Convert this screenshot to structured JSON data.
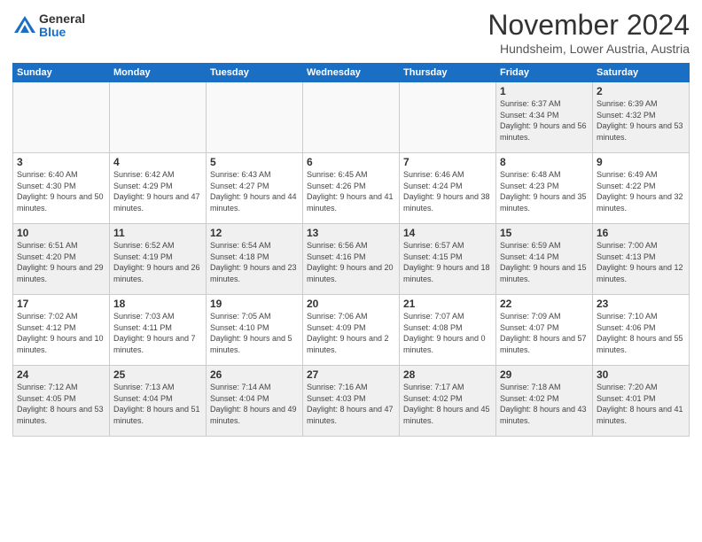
{
  "logo": {
    "general": "General",
    "blue": "Blue"
  },
  "title": {
    "month": "November 2024",
    "location": "Hundsheim, Lower Austria, Austria"
  },
  "weekdays": [
    "Sunday",
    "Monday",
    "Tuesday",
    "Wednesday",
    "Thursday",
    "Friday",
    "Saturday"
  ],
  "weeks": [
    [
      {
        "day": "",
        "info": ""
      },
      {
        "day": "",
        "info": ""
      },
      {
        "day": "",
        "info": ""
      },
      {
        "day": "",
        "info": ""
      },
      {
        "day": "",
        "info": ""
      },
      {
        "day": "1",
        "info": "Sunrise: 6:37 AM\nSunset: 4:34 PM\nDaylight: 9 hours and 56 minutes."
      },
      {
        "day": "2",
        "info": "Sunrise: 6:39 AM\nSunset: 4:32 PM\nDaylight: 9 hours and 53 minutes."
      }
    ],
    [
      {
        "day": "3",
        "info": "Sunrise: 6:40 AM\nSunset: 4:30 PM\nDaylight: 9 hours and 50 minutes."
      },
      {
        "day": "4",
        "info": "Sunrise: 6:42 AM\nSunset: 4:29 PM\nDaylight: 9 hours and 47 minutes."
      },
      {
        "day": "5",
        "info": "Sunrise: 6:43 AM\nSunset: 4:27 PM\nDaylight: 9 hours and 44 minutes."
      },
      {
        "day": "6",
        "info": "Sunrise: 6:45 AM\nSunset: 4:26 PM\nDaylight: 9 hours and 41 minutes."
      },
      {
        "day": "7",
        "info": "Sunrise: 6:46 AM\nSunset: 4:24 PM\nDaylight: 9 hours and 38 minutes."
      },
      {
        "day": "8",
        "info": "Sunrise: 6:48 AM\nSunset: 4:23 PM\nDaylight: 9 hours and 35 minutes."
      },
      {
        "day": "9",
        "info": "Sunrise: 6:49 AM\nSunset: 4:22 PM\nDaylight: 9 hours and 32 minutes."
      }
    ],
    [
      {
        "day": "10",
        "info": "Sunrise: 6:51 AM\nSunset: 4:20 PM\nDaylight: 9 hours and 29 minutes."
      },
      {
        "day": "11",
        "info": "Sunrise: 6:52 AM\nSunset: 4:19 PM\nDaylight: 9 hours and 26 minutes."
      },
      {
        "day": "12",
        "info": "Sunrise: 6:54 AM\nSunset: 4:18 PM\nDaylight: 9 hours and 23 minutes."
      },
      {
        "day": "13",
        "info": "Sunrise: 6:56 AM\nSunset: 4:16 PM\nDaylight: 9 hours and 20 minutes."
      },
      {
        "day": "14",
        "info": "Sunrise: 6:57 AM\nSunset: 4:15 PM\nDaylight: 9 hours and 18 minutes."
      },
      {
        "day": "15",
        "info": "Sunrise: 6:59 AM\nSunset: 4:14 PM\nDaylight: 9 hours and 15 minutes."
      },
      {
        "day": "16",
        "info": "Sunrise: 7:00 AM\nSunset: 4:13 PM\nDaylight: 9 hours and 12 minutes."
      }
    ],
    [
      {
        "day": "17",
        "info": "Sunrise: 7:02 AM\nSunset: 4:12 PM\nDaylight: 9 hours and 10 minutes."
      },
      {
        "day": "18",
        "info": "Sunrise: 7:03 AM\nSunset: 4:11 PM\nDaylight: 9 hours and 7 minutes."
      },
      {
        "day": "19",
        "info": "Sunrise: 7:05 AM\nSunset: 4:10 PM\nDaylight: 9 hours and 5 minutes."
      },
      {
        "day": "20",
        "info": "Sunrise: 7:06 AM\nSunset: 4:09 PM\nDaylight: 9 hours and 2 minutes."
      },
      {
        "day": "21",
        "info": "Sunrise: 7:07 AM\nSunset: 4:08 PM\nDaylight: 9 hours and 0 minutes."
      },
      {
        "day": "22",
        "info": "Sunrise: 7:09 AM\nSunset: 4:07 PM\nDaylight: 8 hours and 57 minutes."
      },
      {
        "day": "23",
        "info": "Sunrise: 7:10 AM\nSunset: 4:06 PM\nDaylight: 8 hours and 55 minutes."
      }
    ],
    [
      {
        "day": "24",
        "info": "Sunrise: 7:12 AM\nSunset: 4:05 PM\nDaylight: 8 hours and 53 minutes."
      },
      {
        "day": "25",
        "info": "Sunrise: 7:13 AM\nSunset: 4:04 PM\nDaylight: 8 hours and 51 minutes."
      },
      {
        "day": "26",
        "info": "Sunrise: 7:14 AM\nSunset: 4:04 PM\nDaylight: 8 hours and 49 minutes."
      },
      {
        "day": "27",
        "info": "Sunrise: 7:16 AM\nSunset: 4:03 PM\nDaylight: 8 hours and 47 minutes."
      },
      {
        "day": "28",
        "info": "Sunrise: 7:17 AM\nSunset: 4:02 PM\nDaylight: 8 hours and 45 minutes."
      },
      {
        "day": "29",
        "info": "Sunrise: 7:18 AM\nSunset: 4:02 PM\nDaylight: 8 hours and 43 minutes."
      },
      {
        "day": "30",
        "info": "Sunrise: 7:20 AM\nSunset: 4:01 PM\nDaylight: 8 hours and 41 minutes."
      }
    ]
  ]
}
